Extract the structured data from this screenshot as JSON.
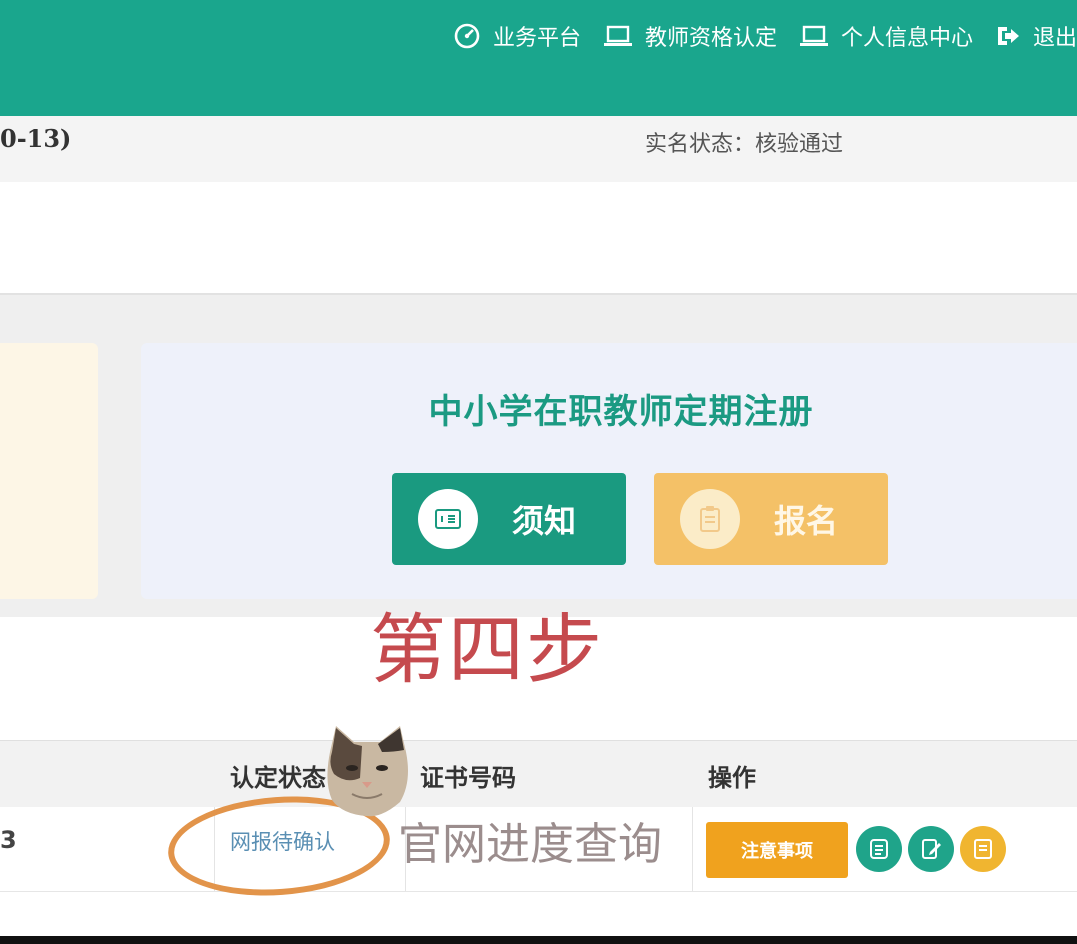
{
  "topnav": {
    "items": [
      {
        "label": "业务平台",
        "icon": "dashboard-icon"
      },
      {
        "label": "教师资格认定",
        "icon": "laptop-icon"
      },
      {
        "label": "个人信息中心",
        "icon": "laptop-icon"
      },
      {
        "label": "退出",
        "icon": "logout-icon"
      }
    ]
  },
  "infobar": {
    "id_suffix": "0-13)",
    "realname_status": "实名状态：核验通过"
  },
  "card": {
    "title": "中小学在职教师定期注册",
    "notice_button": "须知",
    "signup_button": "报名"
  },
  "annotation": {
    "step": "第四步",
    "progress_hint": "官网进度查询"
  },
  "table": {
    "headers": [
      "认定状态",
      "证书号码",
      "操作"
    ],
    "row": {
      "cut_text": "3",
      "status": "网报待确认",
      "attention_button": "注意事项"
    }
  },
  "colors": {
    "brand_green": "#1aa68d",
    "button_green": "#1a9a80",
    "button_orange": "#f4c167",
    "attention_orange": "#f0a21e",
    "step_red": "#c54a4e",
    "ring_orange": "#e2944a"
  }
}
